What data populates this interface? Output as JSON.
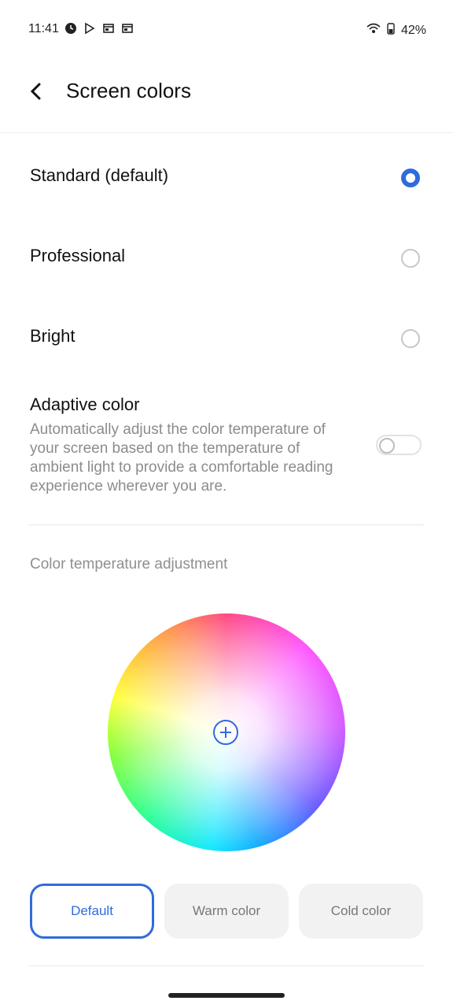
{
  "status_bar": {
    "time": "11:41",
    "battery_percent": "42%",
    "icons": [
      "clock-icon",
      "play-store-icon",
      "calendar-icon",
      "calendar-icon",
      "wifi-icon",
      "battery-icon"
    ]
  },
  "header": {
    "title": "Screen colors"
  },
  "options": [
    {
      "label": "Standard (default)",
      "selected": true
    },
    {
      "label": "Professional",
      "selected": false
    },
    {
      "label": "Bright",
      "selected": false
    }
  ],
  "adaptive": {
    "title": "Adaptive color",
    "description": "Automatically adjust the color temperature of your screen based on the temperature of ambient light to provide a comfortable reading experience wherever you are.",
    "enabled": false
  },
  "temperature": {
    "section_title": "Color temperature adjustment",
    "buttons": [
      {
        "label": "Default",
        "selected": true
      },
      {
        "label": "Warm color",
        "selected": false
      },
      {
        "label": "Cold color",
        "selected": false
      }
    ]
  },
  "colors": {
    "accent": "#2f6bdc",
    "secondary_text": "#8c8c8c",
    "chip_bg": "#f2f2f2"
  }
}
